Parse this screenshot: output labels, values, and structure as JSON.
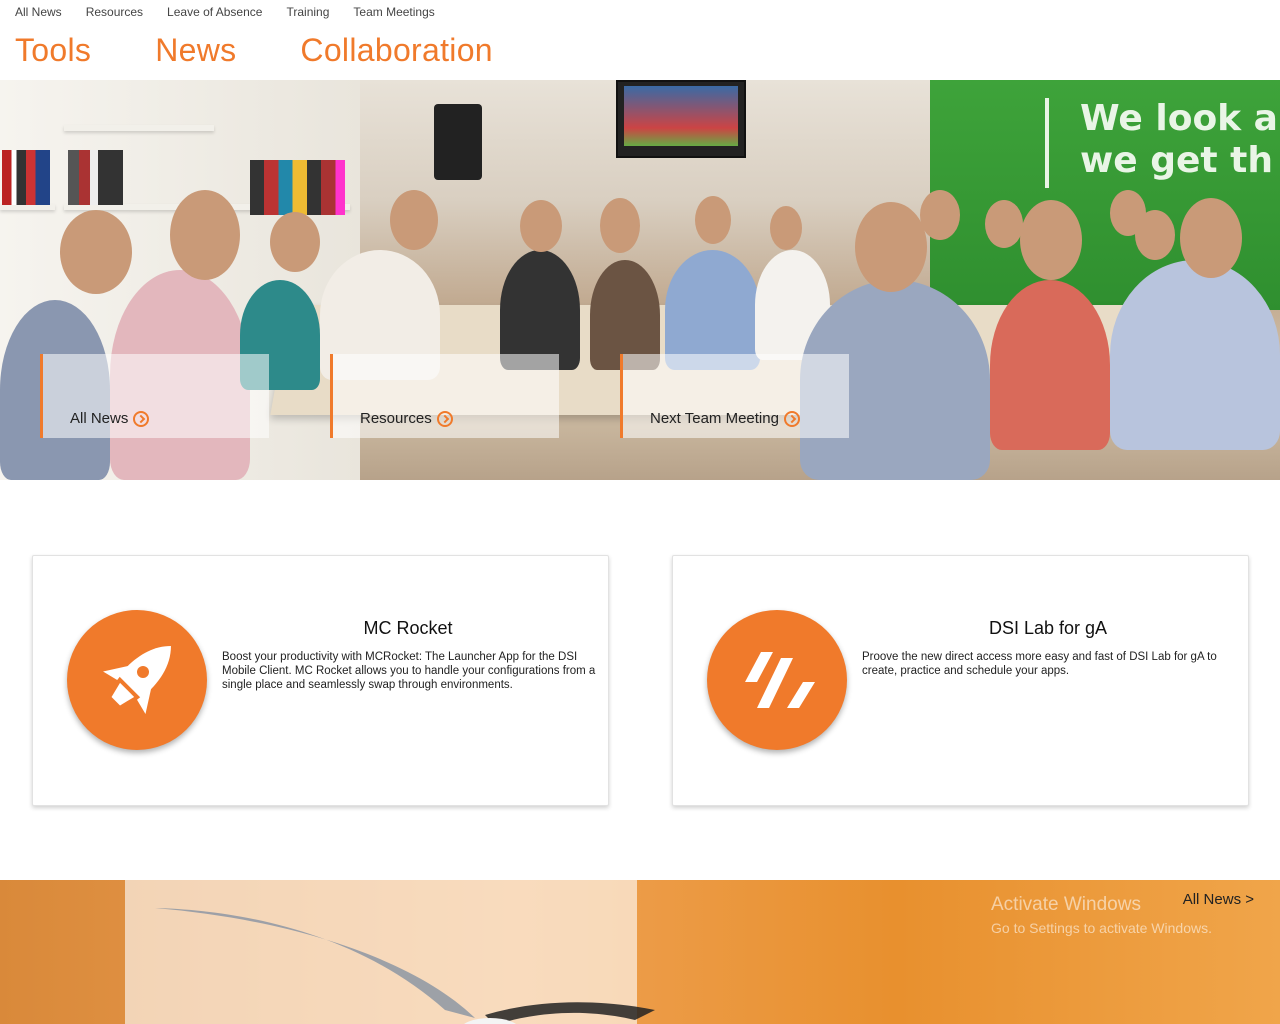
{
  "top_links": [
    "All News",
    "Resources",
    "Leave of Absence",
    "Training",
    "Team Meetings"
  ],
  "main_nav": [
    "Tools",
    "News",
    "Collaboration"
  ],
  "hero": {
    "cards": [
      {
        "label": "All News"
      },
      {
        "label": "Resources"
      },
      {
        "label": "Next Team Meeting"
      }
    ],
    "wall_text": [
      "We look a",
      "we get th"
    ]
  },
  "tiles": [
    {
      "icon": "rocket-icon",
      "title": "MC Rocket",
      "description": "Boost your productivity with MCRocket: The Launcher App for the DSI Mobile Client. MC Rocket allows you to handle your configurations from a single place and seamlessly swap through environments."
    },
    {
      "icon": "slash-logo-icon",
      "title": "DSI Lab for gA",
      "description": "Proove the new direct access more easy and fast of DSI Lab for gA to create, practice and schedule your apps."
    }
  ],
  "bottom": {
    "link": "All News >",
    "watermark_title": "Activate Windows",
    "watermark_sub": "Go to Settings to activate Windows."
  },
  "colors": {
    "accent": "#f07a2b"
  }
}
